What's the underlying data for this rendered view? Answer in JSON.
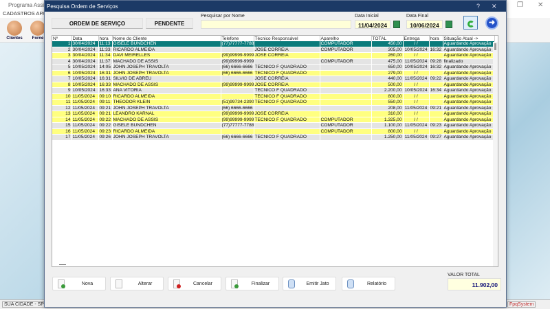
{
  "app": {
    "title": "Programa Assis",
    "menu": "CADASTROS   APA",
    "tools": [
      "Clientes",
      "Forne"
    ],
    "status_left": "SUA CIDADE - SP 11",
    "status_right": "FpqSystem"
  },
  "dialog": {
    "title": "Pesquisa Ordem de Serviços",
    "help": "?",
    "close": "✕"
  },
  "filters": {
    "ordem_label": "ORDEM DE SERVIÇO",
    "pendente_label": "PENDENTE",
    "search_label": "Pesquisar por Nome",
    "search_value": "",
    "data_inicial_label": "Data Inicial",
    "data_inicial": "11/04/2024",
    "data_final_label": "Data Final",
    "data_final": "10/06/2024"
  },
  "table": {
    "headers": [
      "Nº",
      "Data",
      "hora",
      "Nome do Cliente",
      "Telefone",
      "Técnico Responsável",
      "Aparelho",
      "TOTAL",
      "Entrega",
      "hora",
      "Situação Atual ->"
    ],
    "rows": [
      [
        "1",
        "30/04/2024",
        "11:13",
        "GISELE BUNDCHEN",
        "(77)77777-7788",
        "",
        "COMPUTADOR",
        "450,00",
        "/ /",
        "",
        "Aguardando Aprovação"
      ],
      [
        "2",
        "30/04/2024",
        "11:33",
        "RICARDO ALMEIDA",
        "",
        "JOSE CORREIA",
        "COMPUTADOR",
        "305,00",
        "10/05/2024",
        "16:32",
        "Aguardando Aprovação"
      ],
      [
        "3",
        "30/04/2024",
        "11:34",
        "DAVI MEIRELLES",
        "(99)99999-9999",
        "JOSE CORREIA",
        "",
        "260,00",
        "/ /",
        "",
        "Aguardando Aprovação"
      ],
      [
        "4",
        "30/04/2024",
        "11:37",
        "MACHADO DE ASSIS",
        "(99)99999-9999",
        "",
        "COMPUTADOR",
        "475,00",
        "11/05/2024",
        "09:28",
        "finalizado"
      ],
      [
        "5",
        "10/05/2024",
        "14:05",
        "JOHN JOSEPH TRAVOLTA",
        "(66) 6666-6666",
        "TECNICO F QUADRADO",
        "",
        "650,00",
        "10/05/2024",
        "16:32",
        "Aguardando Aprovação"
      ],
      [
        "6",
        "10/05/2024",
        "16:31",
        "JOHN JOSEPH TRAVOLTA",
        "(66) 6666-6666",
        "TECNICO F QUADRADO",
        "",
        "279,00",
        "/ /",
        "",
        "Aguardando Aprovação"
      ],
      [
        "7",
        "10/05/2024",
        "16:31",
        "SILVIO DE ABREU",
        "",
        "JOSE CORREIA",
        "",
        "440,00",
        "11/05/2024",
        "09:22",
        "Aguardando Aprovação"
      ],
      [
        "8",
        "10/05/2024",
        "16:33",
        "MACHADO DE ASSIS",
        "(99)99999-9999",
        "JOSE CORREIA",
        "",
        "500,00",
        "/ /",
        "",
        "Aguardando Aprovação"
      ],
      [
        "9",
        "10/05/2024",
        "16:33",
        "ANA VITÓRIA",
        "",
        "TECNICO F QUADRADO",
        "",
        "2.200,00",
        "10/05/2024",
        "16:34",
        "Aguardando Aprovação"
      ],
      [
        "10",
        "11/05/2024",
        "09:10",
        "RICARDO ALMEIDA",
        "",
        "TECNICO F QUADRADO",
        "",
        "800,00",
        "/ /",
        "",
        "Aguardando Aprovação"
      ],
      [
        "11",
        "11/05/2024",
        "09:11",
        "THEODOR KLEIN",
        "(51)99734-2390",
        "TECNICO F QUADRADO",
        "",
        "550,00",
        "/ /",
        "",
        "Aguardando Aprovação"
      ],
      [
        "12",
        "11/05/2024",
        "09:21",
        "JOHN JOSEPH TRAVOLTA",
        "(66) 6666-6666",
        "",
        "",
        "208,00",
        "11/05/2024",
        "09:21",
        "Aguardando Aprovação"
      ],
      [
        "13",
        "11/05/2024",
        "09:21",
        "LEANDRO KARNAL",
        "(99)99999-9999",
        "JOSE CORREIA",
        "",
        "310,00",
        "/ /",
        "",
        "Aguardando Aprovação"
      ],
      [
        "14",
        "11/05/2024",
        "09:22",
        "MACHADO DE ASSIS",
        "(99)99999-9999",
        "TECNICO F QUADRADO",
        "COMPUTADOR",
        "1.325,00",
        "/ /",
        "",
        "Aguardando Aprovação"
      ],
      [
        "15",
        "11/05/2024",
        "09:22",
        "GISELE BUNDCHEN",
        "(77)77777-7788",
        "",
        "COMPUTADOR",
        "1.100,00",
        "11/05/2024",
        "09:23",
        "Aguardando Aprovação"
      ],
      [
        "16",
        "11/05/2024",
        "09:23",
        "RICARDO ALMEIDA",
        "",
        "",
        "COMPUTADOR",
        "800,00",
        "/ /",
        "",
        "Aguardando Aprovação"
      ],
      [
        "17",
        "11/05/2024",
        "09:26",
        "JOHN JOSEPH TRAVOLTA",
        "(66) 6666-6666",
        "TECNICO F QUADRADO",
        "",
        "1.250,00",
        "11/05/2024",
        "09:27",
        "Aguardando Aprovação"
      ]
    ],
    "row_styles": [
      "s",
      "g",
      "y",
      "g",
      "g",
      "y",
      "g",
      "y",
      "g",
      "y",
      "y",
      "g",
      "y",
      "y",
      "g",
      "y",
      "g"
    ]
  },
  "actions": [
    {
      "label": "Nova",
      "icon": "new-document-icon",
      "color": "#3a9a3a"
    },
    {
      "label": "Alterar",
      "icon": "pencil-icon",
      "color": ""
    },
    {
      "label": "Cancelar",
      "icon": "cancel-document-icon",
      "color": "#d02020"
    },
    {
      "label": "Finalizar",
      "icon": "check-document-icon",
      "color": "#3a9a3a"
    },
    {
      "label": "Emitir Jato",
      "icon": "printer-icon",
      "color": ""
    },
    {
      "label": "Relatório",
      "icon": "report-printer-icon",
      "color": ""
    }
  ],
  "summary": {
    "label": "VALOR TOTAL",
    "value": "11.902,00"
  }
}
